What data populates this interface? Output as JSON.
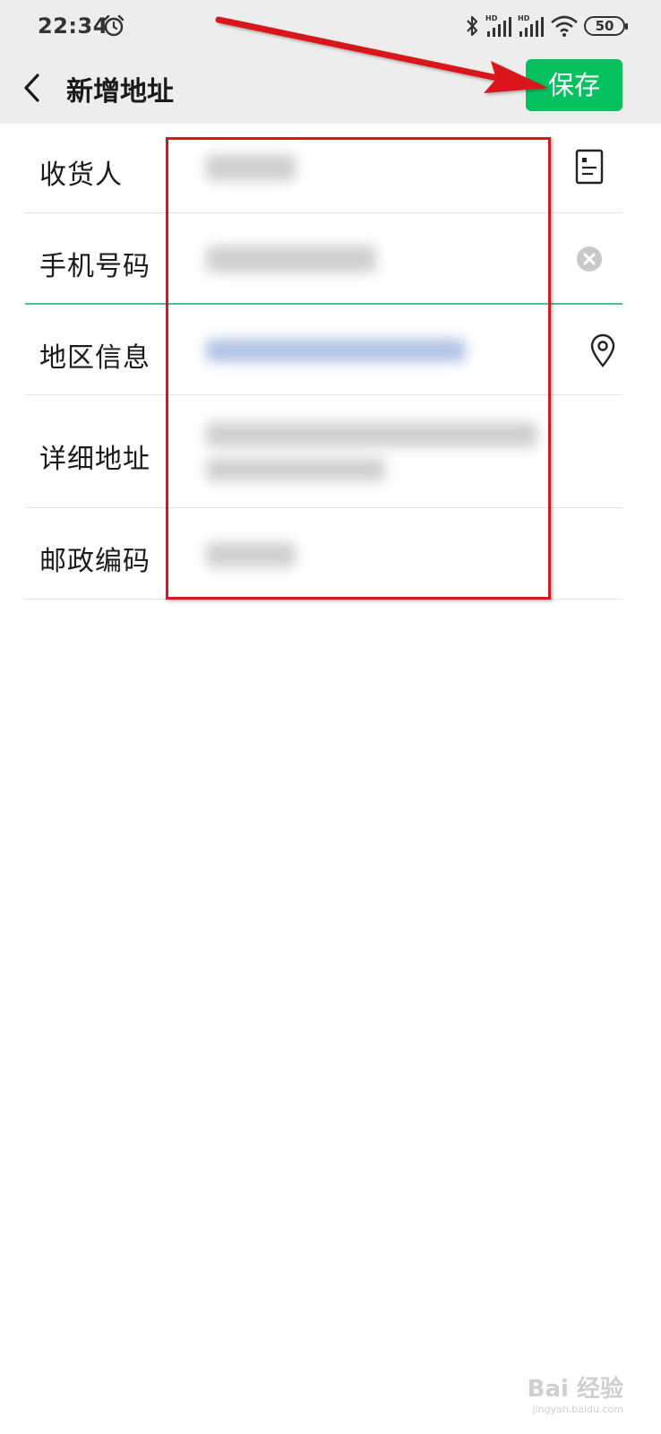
{
  "status_bar": {
    "time": "22:34",
    "battery": "50",
    "icons": [
      "alarm-icon",
      "bluetooth-icon",
      "signal-hd-icon",
      "signal-hd-icon",
      "wifi-icon",
      "battery-icon"
    ]
  },
  "header": {
    "title": "新增地址",
    "save_label": "保存",
    "back_icon": "chevron-left-icon"
  },
  "form": {
    "fields": [
      {
        "label": "收货人",
        "icon": "contact-card-icon"
      },
      {
        "label": "手机号码",
        "icon": "clear-icon"
      },
      {
        "label": "地区信息",
        "icon": "location-pin-icon"
      },
      {
        "label": "详细地址"
      },
      {
        "label": "邮政编码"
      }
    ]
  },
  "colors": {
    "accent": "#07c160",
    "annotation": "#d9161c",
    "focus_line": "#4cbf9a"
  },
  "watermark": {
    "brand": "Bai 经验",
    "domain": "jingyan.baidu.com"
  }
}
